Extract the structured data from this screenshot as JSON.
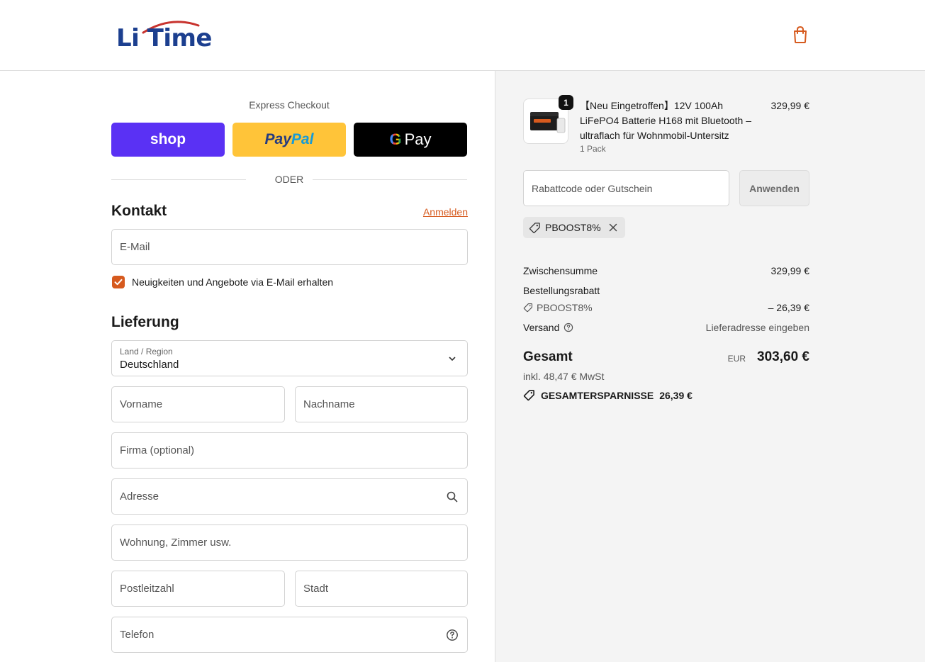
{
  "brand": {
    "logo_text": "Li Time",
    "accent": "#d65a1e",
    "logo_blue": "#1c3f8f",
    "logo_arc": "#c8332e"
  },
  "header": {
    "cart_icon": "shopping-bag-icon"
  },
  "express": {
    "title": "Express Checkout",
    "shop_label": "shop",
    "paypal_pay": "Pay",
    "paypal_pal": "Pal",
    "gpay_g": "G",
    "gpay_label": "Pay",
    "divider": "ODER"
  },
  "contact": {
    "title": "Kontakt",
    "login_link": "Anmelden",
    "email_placeholder": "E-Mail",
    "newsletter_label": "Neuigkeiten und Angebote via E-Mail erhalten",
    "newsletter_checked": true
  },
  "delivery": {
    "title": "Lieferung",
    "country_label": "Land / Region",
    "country_value": "Deutschland",
    "first_name": "Vorname",
    "last_name": "Nachname",
    "company": "Firma (optional)",
    "address": "Adresse",
    "apartment": "Wohnung, Zimmer usw.",
    "postal_code": "Postleitzahl",
    "city": "Stadt",
    "phone": "Telefon"
  },
  "summary": {
    "product": {
      "quantity": "1",
      "name": "【Neu Eingetroffen】12V 100Ah LiFePO4 Batterie H168 mit Bluetooth – ultraflach für Wohnmobil-Untersitz",
      "variant": "1 Pack",
      "price": "329,99 €"
    },
    "discount_placeholder": "Rabattcode oder Gutschein",
    "apply_label": "Anwenden",
    "applied_code": "PBOOST8%",
    "subtotal_label": "Zwischensumme",
    "subtotal_value": "329,99 €",
    "order_discount_label": "Bestellungsrabatt",
    "order_discount_code": "PBOOST8%",
    "order_discount_value": "– 26,39 €",
    "shipping_label": "Versand",
    "shipping_value": "Lieferadresse eingeben",
    "total_label": "Gesamt",
    "total_currency": "EUR",
    "total_value": "303,60 €",
    "tax_note": "inkl. 48,47 € MwSt",
    "savings_label": "GESAMTERSPARNISSE",
    "savings_value": "26,39 €"
  }
}
